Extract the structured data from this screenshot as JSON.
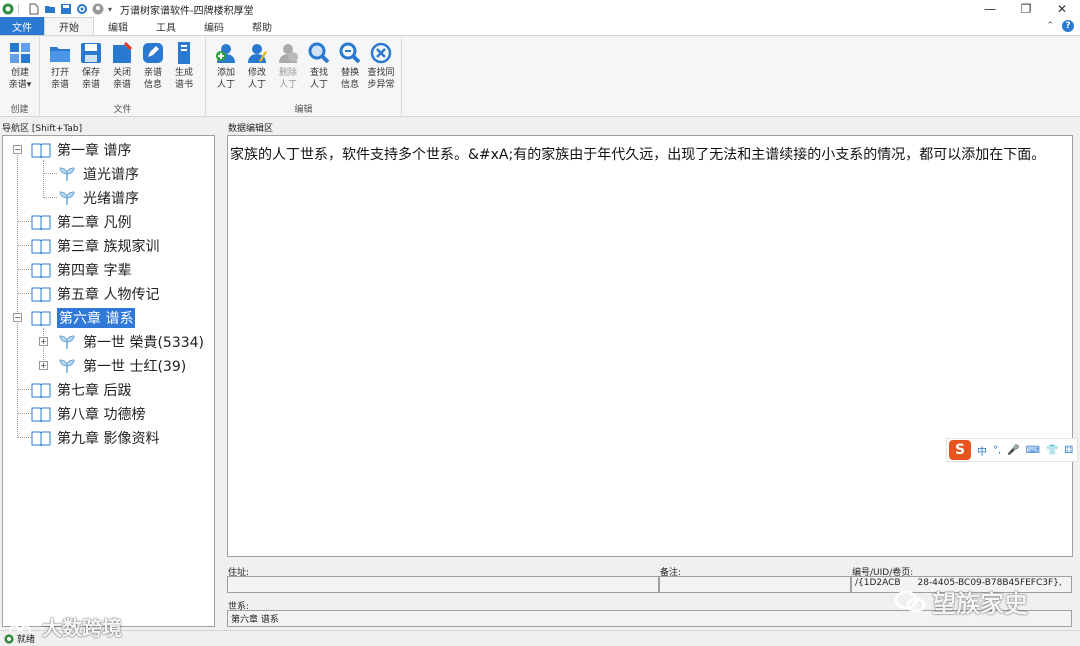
{
  "window": {
    "title": "万谱树家谱软件-四牌楼积厚堂"
  },
  "menu": {
    "tabs": [
      "文件",
      "开始",
      "编辑",
      "工具",
      "编码",
      "帮助"
    ]
  },
  "ribbon": {
    "groups": {
      "create": "创建",
      "file": "文件",
      "edit": "编辑"
    },
    "buttons": {
      "create": [
        "创建",
        "亲谱▾"
      ],
      "open": [
        "打开",
        "亲谱"
      ],
      "save": [
        "保存",
        "亲谱"
      ],
      "close": [
        "关闭",
        "亲谱"
      ],
      "info": [
        "亲谱",
        "信息"
      ],
      "generate": [
        "生成",
        "谱书"
      ],
      "add": [
        "添加",
        "人丁"
      ],
      "modify": [
        "修改",
        "人丁"
      ],
      "delete": [
        "删除",
        "人丁"
      ],
      "find": [
        "查找",
        "人丁"
      ],
      "replace": [
        "替换",
        "信息"
      ],
      "sync": [
        "查找同",
        "步异常"
      ]
    }
  },
  "nav": {
    "label": "导航区 [Shift+Tab]",
    "items": [
      "第一章 谱序",
      "道光谱序",
      "光绪谱序",
      "第二章 凡例",
      "第三章 族规家训",
      "第四章 字辈",
      "第五章 人物传记",
      "第六章 谱系",
      "第一世 榮貴(5334)",
      "第一世 士红(39)",
      "第七章 后跋",
      "第八章 功德榜",
      "第九章 影像资料"
    ]
  },
  "editor": {
    "label": "数据编辑区",
    "content": "家族的人丁世系，软件支持多个世系。&#xA;有的家族由于年代久远，出现了无法和主谱续接的小支系的情况，都可以添加在下面。"
  },
  "ime": {
    "logo": "S",
    "items": [
      "中",
      "°,",
      "🎤",
      "⌨",
      "👕",
      "⚃"
    ]
  },
  "fields": {
    "address_label": "住址:",
    "address_value": "",
    "note_label": "备注:",
    "note_value": "",
    "uid_label": "编号/UID/卷页:",
    "uid_value": "/{1D2ACB",
    "uid_value_tail": "28-4405-BC09-B78B45FEFC3F},",
    "lineage_label": "世系:",
    "lineage_value": "第六章 谱系"
  },
  "status": {
    "text": "就绪"
  },
  "watermarks": {
    "left": "大数跨境",
    "right": "望族家史"
  },
  "colors": {
    "accent": "#2a79d0",
    "selection": "#3079d8",
    "ime": "#e8541e"
  }
}
